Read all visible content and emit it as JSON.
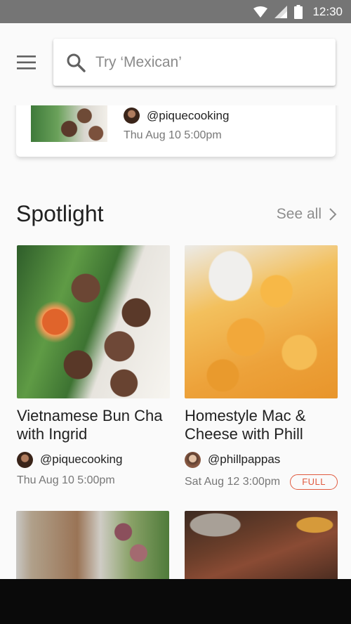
{
  "status_bar": {
    "time": "12:30",
    "icons": [
      "wifi-icon",
      "signal-icon",
      "battery-icon"
    ],
    "background": "#757575"
  },
  "top_bar": {
    "menu_icon": "menu-icon",
    "search": {
      "placeholder": "Try ‘Mexican’",
      "value": "",
      "icon": "search-icon"
    }
  },
  "featured": {
    "handle": "@piquecooking",
    "date": "Thu Aug 10 5:00pm"
  },
  "spotlight": {
    "title": "Spotlight",
    "see_all": "See all",
    "cards": [
      {
        "title": "Vietnamese Bun Cha with Ingrid",
        "handle": "@piquecooking",
        "date": "Thu Aug 10 5:00pm",
        "badge": ""
      },
      {
        "title": "Homestyle Mac & Cheese with Phill",
        "handle": "@phillpappas",
        "date": "Sat Aug 12 3:00pm",
        "badge": "FULL"
      }
    ]
  },
  "colors": {
    "accent_badge": "#e05a3f",
    "secondary_text": "#777777",
    "background": "#fafafa"
  }
}
